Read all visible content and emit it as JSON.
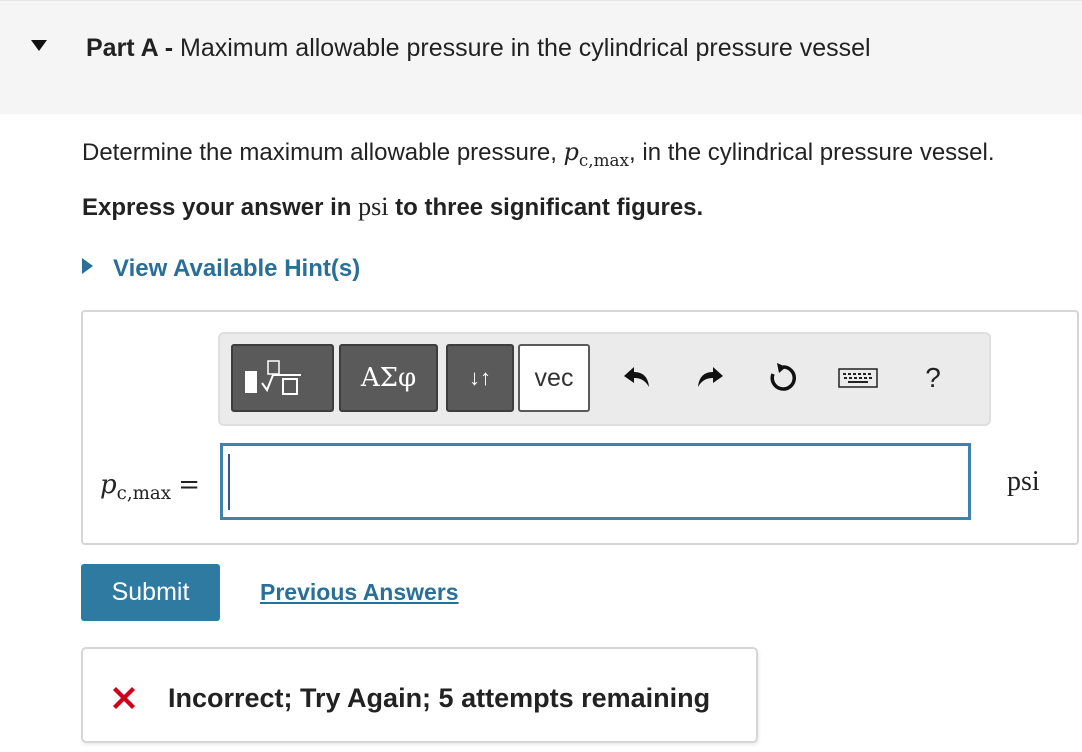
{
  "part": {
    "label": "Part A -",
    "title": "Maximum allowable pressure in the cylindrical pressure vessel"
  },
  "question": {
    "prefix": "Determine the maximum allowable pressure,",
    "var_symbol": "p",
    "var_subscript": "c,max",
    "suffix": ", in the cylindrical pressure vessel."
  },
  "instruction": {
    "before": "Express your answer in",
    "unit": "psi",
    "after": "to three significant figures."
  },
  "hints": {
    "label": "View Available Hint(s)"
  },
  "toolbar": {
    "greek_label": "ΑΣφ",
    "arrows_label": "↓↑",
    "vec_label": "vec",
    "help_label": "?",
    "icons": [
      "templates-icon",
      "undo-icon",
      "redo-icon",
      "reset-icon",
      "keyboard-icon",
      "help-icon"
    ]
  },
  "answer": {
    "var_symbol": "p",
    "var_subscript": "c,max",
    "equals": "=",
    "value": "",
    "unit": "psi"
  },
  "actions": {
    "submit_label": "Submit",
    "previous_answers_label": "Previous Answers"
  },
  "feedback": {
    "message": "Incorrect; Try Again; 5 attempts remaining",
    "status_color": "#d0021b"
  },
  "colors": {
    "accent": "#2a6f97",
    "submit_bg": "#2f7aa0",
    "input_border": "#3e82b0",
    "toolbar_button": "#5a5a5a"
  }
}
